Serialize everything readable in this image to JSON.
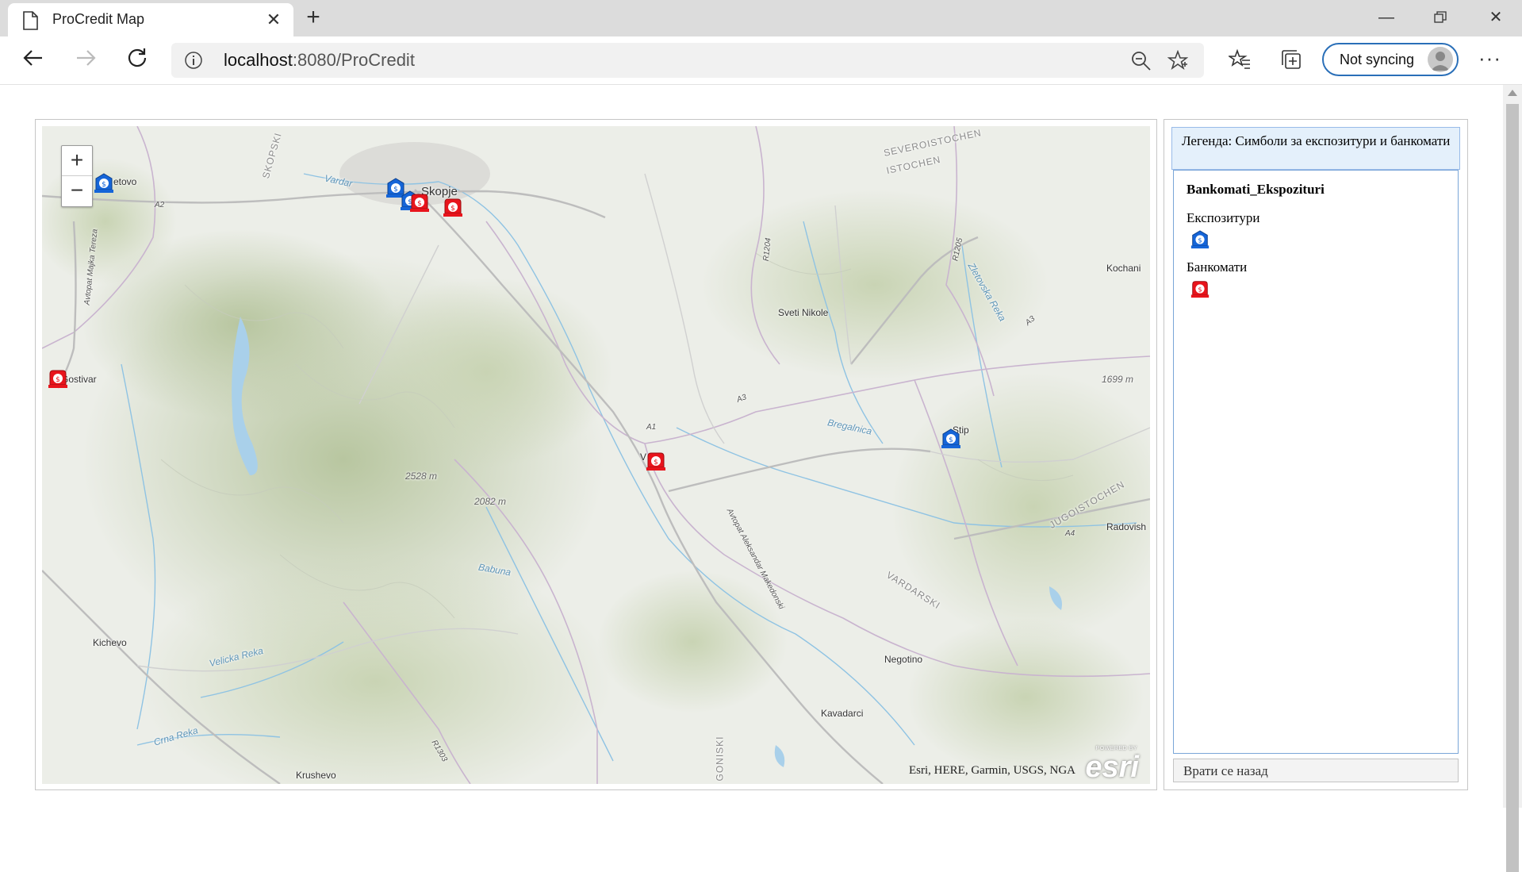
{
  "browser": {
    "tab_title": "ProCredit Map",
    "url_host": "localhost",
    "url_rest": ":8080/ProCredit",
    "sync_label": "Not syncing"
  },
  "map": {
    "attribution": "Esri, HERE, Garmin, USGS, NGA",
    "powered_by": "POWERED BY",
    "esri_word": "esri",
    "zoom_in": "+",
    "zoom_out": "−",
    "labels": {
      "skopje": "Skopje",
      "tetovo": "etovo",
      "gostivar": "Gostivar",
      "kichevo": "Kichevo",
      "krushevo": "Krushevo",
      "sveti_nikole": "Sveti Nikole",
      "kochani": "Kochani",
      "stip": "Stip",
      "veles": "V",
      "radovish": "Radovish",
      "negotino": "Negotino",
      "kavadarci": "Kavadarci",
      "severoistochen": "SEVEROISTOCHEN",
      "istochen": "ISTOCHEN",
      "jugoistochen": "JUGOISTOCHEN",
      "vardarski": "VARDARSKI",
      "skopski": "SKOPSKI",
      "goniski": "GONISKI",
      "elev1": "2528 m",
      "elev2": "2082 m",
      "elev3": "1699 m",
      "vardar": "Vardar",
      "babuna": "Babuna",
      "bregalnica": "Bregalnica",
      "velicka": "Velicka Reka",
      "crna": "Crna Reka",
      "zletovska": "Zletovska Reka",
      "a1": "A1",
      "a2": "A2",
      "a3": "A3",
      "a3b": "A3",
      "a4": "A4",
      "r1204": "R1204",
      "r1205": "R1205",
      "r1303": "R1303",
      "avtopat_mt": "Avtopat Majka Tereza",
      "avtopat_am": "Avtopat Aleksandar Makedonski"
    },
    "markers": {
      "branch_icon": "branch-bank-icon",
      "atm_icon": "atm-icon",
      "branch_color": "#1565d8",
      "atm_color": "#e8141c"
    }
  },
  "legend": {
    "header": "Легенда: Симболи за експозитури и банкомати",
    "layer_title": "Bankomati_Ekspozituri",
    "items": [
      {
        "label": "Експозитури",
        "icon": "branch-bank-icon"
      },
      {
        "label": "Банкомати",
        "icon": "atm-icon"
      }
    ],
    "back_button": "Врати се назад"
  }
}
